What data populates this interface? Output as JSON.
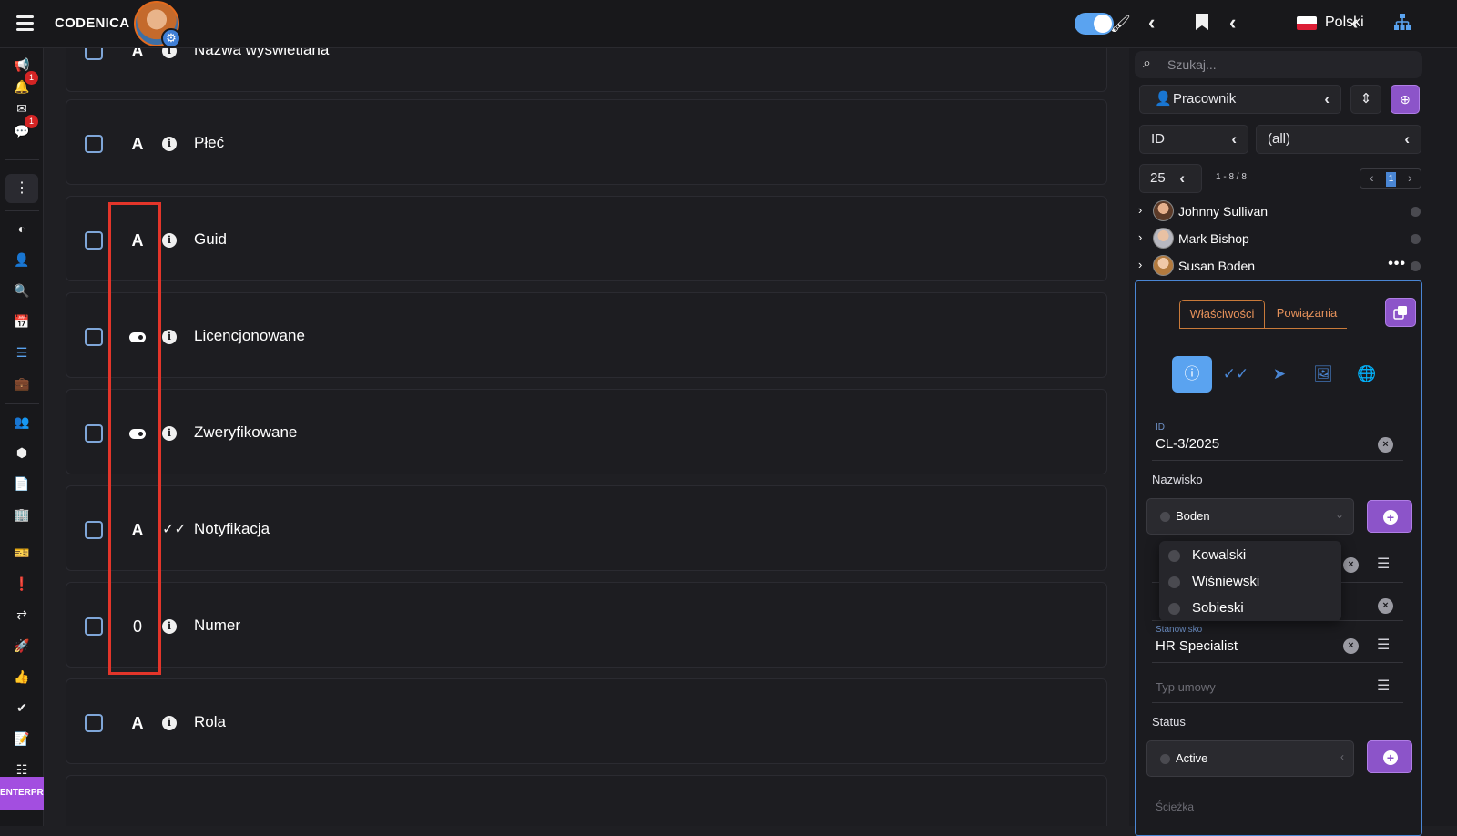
{
  "app": {
    "brand": "CODENICA",
    "language": "Polski"
  },
  "rail": {
    "badge_bell": "1",
    "badge_chat": "1",
    "enterprise": "ENTERPRISE"
  },
  "rows": [
    {
      "type": "A",
      "label": "Nazwa wyświetlana",
      "info": "i"
    },
    {
      "type": "A",
      "label": "Płeć",
      "info": "i"
    },
    {
      "type": "A",
      "label": "Guid",
      "info": "i"
    },
    {
      "type": "toggle",
      "label": "Licencjonowane",
      "info": "i"
    },
    {
      "type": "toggle",
      "label": "Zweryfikowane",
      "info": "i"
    },
    {
      "type": "A",
      "label": "Notyfikacja",
      "info": "check"
    },
    {
      "type": "0",
      "label": "Numer",
      "info": "i"
    },
    {
      "type": "A",
      "label": "Rola",
      "info": "i"
    }
  ],
  "panel": {
    "search_placeholder": "Szukaj...",
    "entity": "Pracownik",
    "filter_field": "ID",
    "filter_value": "(all)",
    "page_size": "25",
    "range": "1 - 8 / 8",
    "page": "1",
    "people": [
      "Johnny Sullivan",
      "Mark Bishop",
      "Susan Boden"
    ],
    "tabs": {
      "properties": "Właściwości",
      "relations": "Powiązania"
    },
    "fields": {
      "id_label": "ID",
      "id_value": "CL-3/2025",
      "surname_label": "Nazwisko",
      "surname_value": "Boden",
      "position_label": "Stanowisko",
      "position_value": "HR Specialist",
      "contract_placeholder": "Typ umowy",
      "status_label": "Status",
      "status_value": "Active",
      "path_label": "Ścieżka"
    },
    "dropdown": [
      "Kowalski",
      "Wiśniewski",
      "Sobieski"
    ]
  },
  "colors": {
    "accent_blue": "#5aa3f0",
    "purple": "#8c54c9",
    "highlight_red": "#e3352a",
    "tab_orange": "#e5915a"
  }
}
